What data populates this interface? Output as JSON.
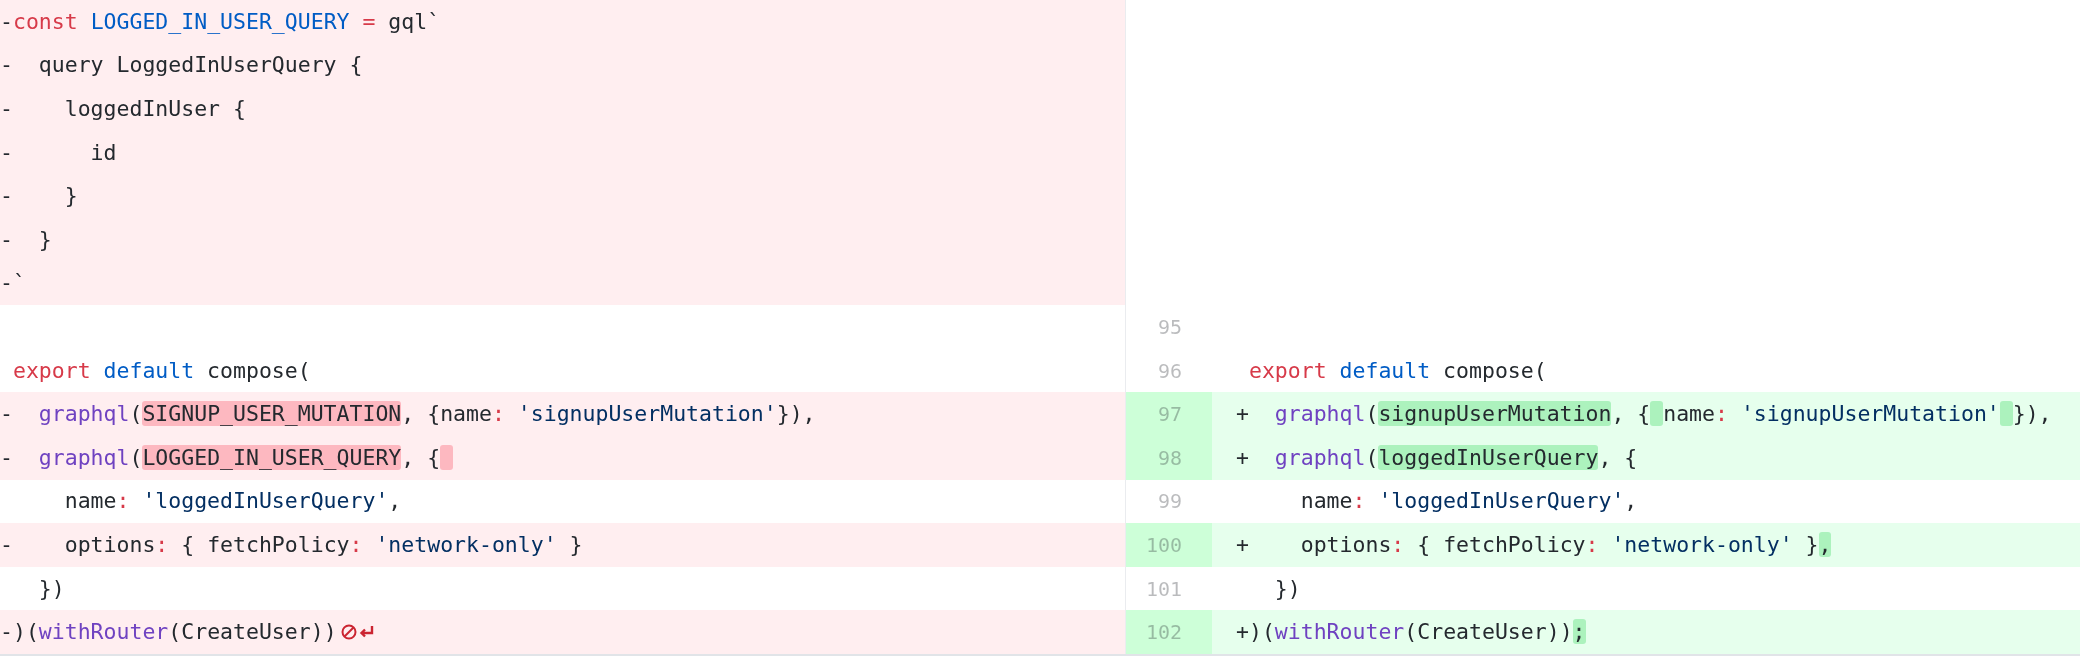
{
  "rows": [
    {
      "left": {
        "kind": "deleted",
        "marker": "-",
        "tokens": [
          {
            "t": "const",
            "kind": "kw"
          },
          {
            "t": " LOGGED_IN_USER_QUERY",
            "kind": "const"
          },
          {
            "t": " =",
            "kind": "kw"
          },
          {
            "t": " gql`"
          }
        ]
      },
      "right": {
        "kind": "empty"
      }
    },
    {
      "left": {
        "kind": "deleted",
        "marker": "-",
        "tokens": [
          {
            "t": "  query LoggedInUserQuery {"
          }
        ]
      },
      "right": {
        "kind": "empty"
      }
    },
    {
      "left": {
        "kind": "deleted",
        "marker": "-",
        "tokens": [
          {
            "t": "    loggedInUser {"
          }
        ]
      },
      "right": {
        "kind": "empty"
      }
    },
    {
      "left": {
        "kind": "deleted",
        "marker": "-",
        "tokens": [
          {
            "t": "      id"
          }
        ]
      },
      "right": {
        "kind": "empty"
      }
    },
    {
      "left": {
        "kind": "deleted",
        "marker": "-",
        "tokens": [
          {
            "t": "    }"
          }
        ]
      },
      "right": {
        "kind": "empty"
      }
    },
    {
      "left": {
        "kind": "deleted",
        "marker": "-",
        "tokens": [
          {
            "t": "  }"
          }
        ]
      },
      "right": {
        "kind": "empty"
      }
    },
    {
      "left": {
        "kind": "deleted",
        "marker": "-",
        "tokens": [
          {
            "t": "`"
          }
        ]
      },
      "right": {
        "kind": "empty"
      }
    },
    {
      "left": {
        "kind": "context"
      },
      "right": {
        "kind": "context",
        "number": "95"
      }
    },
    {
      "left": {
        "kind": "context",
        "tokens": [
          {
            "t": " export",
            "kind": "kw"
          },
          {
            "t": " default",
            "kind": "const"
          },
          {
            "t": " compose("
          }
        ]
      },
      "right": {
        "kind": "context",
        "number": "96",
        "tokens": [
          {
            "t": " export",
            "kind": "kw"
          },
          {
            "t": " default",
            "kind": "const"
          },
          {
            "t": " compose("
          }
        ]
      }
    },
    {
      "left": {
        "kind": "deleted",
        "marker": "-",
        "tokens": [
          {
            "t": "  graphql",
            "kind": "fn"
          },
          {
            "t": "("
          },
          {
            "t": "SIGNUP_USER_MUTATION",
            "hl": true
          },
          {
            "t": ", {name"
          },
          {
            "t": ":",
            "kind": "kw"
          },
          {
            "t": " 'signupUserMutation'",
            "kind": "str"
          },
          {
            "t": "}),"
          }
        ]
      },
      "right": {
        "kind": "added",
        "number": "97",
        "marker": "+",
        "tokens": [
          {
            "t": "  graphql",
            "kind": "fn"
          },
          {
            "t": "("
          },
          {
            "t": "signupUserMutation",
            "hl": true
          },
          {
            "t": ", {"
          },
          {
            "kind": "gap",
            "hl": true
          },
          {
            "t": "name"
          },
          {
            "t": ":",
            "kind": "kw"
          },
          {
            "t": " 'signupUserMutation'",
            "kind": "str"
          },
          {
            "kind": "gap",
            "hl": true
          },
          {
            "t": "}),"
          }
        ]
      }
    },
    {
      "left": {
        "kind": "deleted",
        "marker": "-",
        "tokens": [
          {
            "t": "  graphql",
            "kind": "fn"
          },
          {
            "t": "("
          },
          {
            "t": "LOGGED_IN_USER_QUERY",
            "hl": true
          },
          {
            "t": ", {"
          },
          {
            "kind": "gap",
            "hl": true
          }
        ]
      },
      "right": {
        "kind": "added",
        "number": "98",
        "marker": "+",
        "tokens": [
          {
            "t": "  graphql",
            "kind": "fn"
          },
          {
            "t": "("
          },
          {
            "t": "loggedInUserQuery",
            "hl": true
          },
          {
            "t": ", {"
          }
        ]
      }
    },
    {
      "left": {
        "kind": "context",
        "tokens": [
          {
            "t": "     name"
          },
          {
            "t": ":",
            "kind": "kw"
          },
          {
            "t": " 'loggedInUserQuery'",
            "kind": "str"
          },
          {
            "t": ","
          }
        ]
      },
      "right": {
        "kind": "context",
        "number": "99",
        "tokens": [
          {
            "t": "     name"
          },
          {
            "t": ":",
            "kind": "kw"
          },
          {
            "t": " 'loggedInUserQuery'",
            "kind": "str"
          },
          {
            "t": ","
          }
        ]
      }
    },
    {
      "left": {
        "kind": "deleted",
        "marker": "-",
        "tokens": [
          {
            "t": "    options"
          },
          {
            "t": ":",
            "kind": "kw"
          },
          {
            "t": " { fetchPolicy"
          },
          {
            "t": ":",
            "kind": "kw"
          },
          {
            "t": " 'network-only'",
            "kind": "str"
          },
          {
            "t": " }"
          }
        ]
      },
      "right": {
        "kind": "added",
        "number": "100",
        "marker": "+",
        "tokens": [
          {
            "t": "    options"
          },
          {
            "t": ":",
            "kind": "kw"
          },
          {
            "t": " { fetchPolicy"
          },
          {
            "t": ":",
            "kind": "kw"
          },
          {
            "t": " 'network-only'",
            "kind": "str"
          },
          {
            "t": " }"
          },
          {
            "t": ",",
            "hl": true
          }
        ]
      }
    },
    {
      "left": {
        "kind": "context",
        "tokens": [
          {
            "t": "   })"
          }
        ]
      },
      "right": {
        "kind": "context",
        "number": "101",
        "tokens": [
          {
            "t": "   })"
          }
        ]
      }
    },
    {
      "left": {
        "kind": "deleted",
        "marker": "-",
        "no_newline": true,
        "tokens": [
          {
            "t": ")("
          },
          {
            "t": "withRouter",
            "kind": "fn"
          },
          {
            "t": "(CreateUser))"
          }
        ]
      },
      "right": {
        "kind": "added",
        "number": "102",
        "marker": "+",
        "tokens": [
          {
            "t": ")("
          },
          {
            "t": "withRouter",
            "kind": "fn"
          },
          {
            "t": "(CreateUser))"
          },
          {
            "t": ";",
            "hl": true
          }
        ]
      }
    }
  ]
}
